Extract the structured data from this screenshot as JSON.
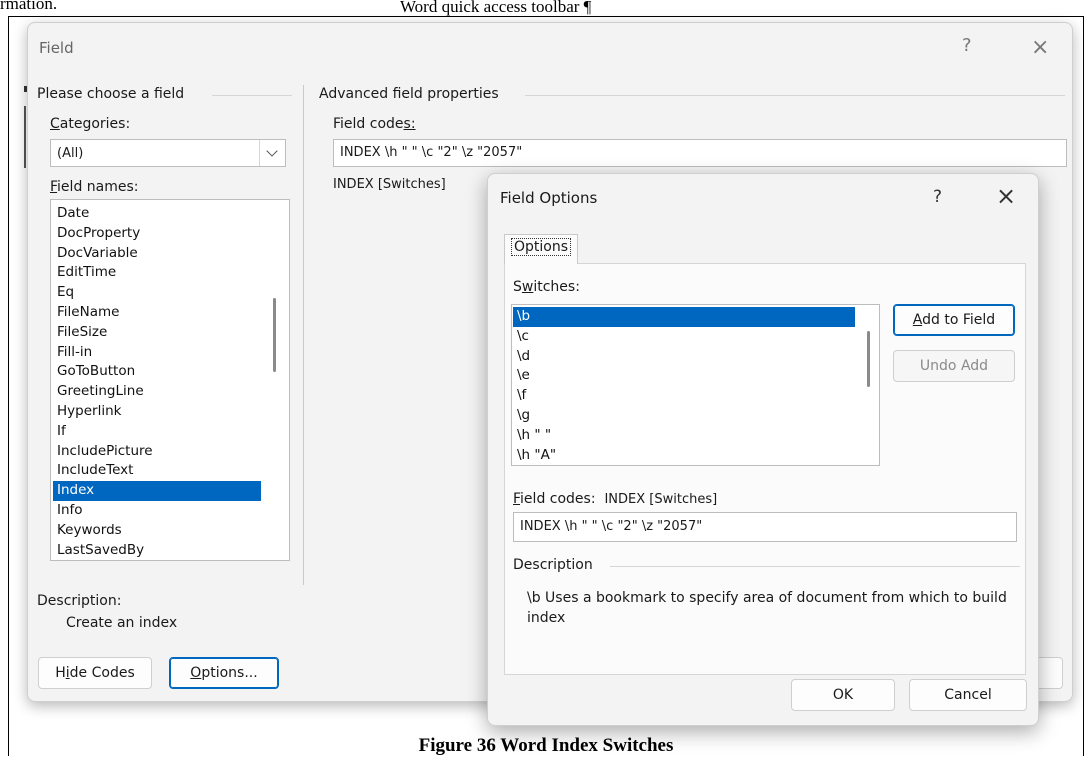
{
  "document": {
    "top_left_text": "rmation.",
    "top_center_text": "Word quick access toolbar ¶",
    "caption": "Figure 36 Word Index Switches"
  },
  "field_dialog": {
    "title": "Field",
    "help_glyph": "?",
    "close_glyph": "×",
    "choose_group_label": "Please choose a field",
    "categories_label": "Categories:",
    "categories_value": "(All)",
    "field_names_label": "Field names:",
    "field_names": [
      "Date",
      "DocProperty",
      "DocVariable",
      "EditTime",
      "Eq",
      "FileName",
      "FileSize",
      "Fill-in",
      "GoToButton",
      "GreetingLine",
      "Hyperlink",
      "If",
      "IncludePicture",
      "IncludeText",
      "Index",
      "Info",
      "Keywords",
      "LastSavedBy"
    ],
    "selected_field": "Index",
    "advanced_group_label": "Advanced field properties",
    "field_codes_label": "Field codes:",
    "field_codes_value": "INDEX \\h \" \" \\c \"2\" \\z \"2057\"",
    "field_syntax": "INDEX [Switches]",
    "description_label": "Description:",
    "description_text": "Create an index",
    "hide_codes_button": "Hide Codes",
    "options_button": "Options..."
  },
  "options_dialog": {
    "title": "Field Options",
    "help_glyph": "?",
    "close_glyph": "×",
    "tab_label": "Options",
    "switches_label": "Switches:",
    "switches": [
      "\\b",
      "\\c",
      "\\d",
      "\\e",
      "\\f",
      "\\g",
      "\\h \" \"",
      "\\h \"A\""
    ],
    "selected_switch": "\\b",
    "add_to_field_button": "Add to Field",
    "undo_add_button": "Undo Add",
    "field_codes_label": "Field codes:",
    "field_codes_syntax": "INDEX [Switches]",
    "field_codes_value": "INDEX \\h \" \" \\c \"2\" \\z \"2057\"",
    "description_group_label": "Description",
    "description_text": "\\b Uses a bookmark to specify area of document from which to build index",
    "ok_button": "OK",
    "cancel_button": "Cancel"
  }
}
